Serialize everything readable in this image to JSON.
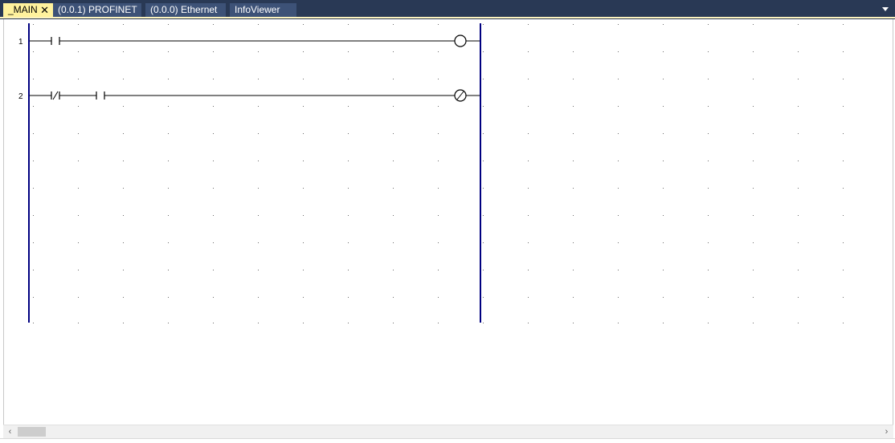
{
  "tabs": [
    {
      "label": "_MAIN",
      "active": true,
      "closable": true
    },
    {
      "label": "(0.0.1) PROFINET",
      "active": false
    },
    {
      "label": "(0.0.0) Ethernet",
      "active": false
    },
    {
      "label": "InfoViewer",
      "active": false
    }
  ],
  "tab_close_symbol": "✕",
  "tab_dropdown_icon": "chevron-down-icon",
  "ladder": {
    "rungs": [
      {
        "number": "1",
        "contacts": [
          "normally-open"
        ],
        "coil": "output-coil"
      },
      {
        "number": "2",
        "contacts": [
          "normally-closed",
          "normally-open"
        ],
        "coil": "negated-coil"
      }
    ]
  },
  "scrollbar": {
    "left_arrow": "‹",
    "right_arrow": "›"
  },
  "colors": {
    "tabbar_bg": "#293955",
    "active_tab": "#fff29d",
    "power_rail": "#000080"
  }
}
